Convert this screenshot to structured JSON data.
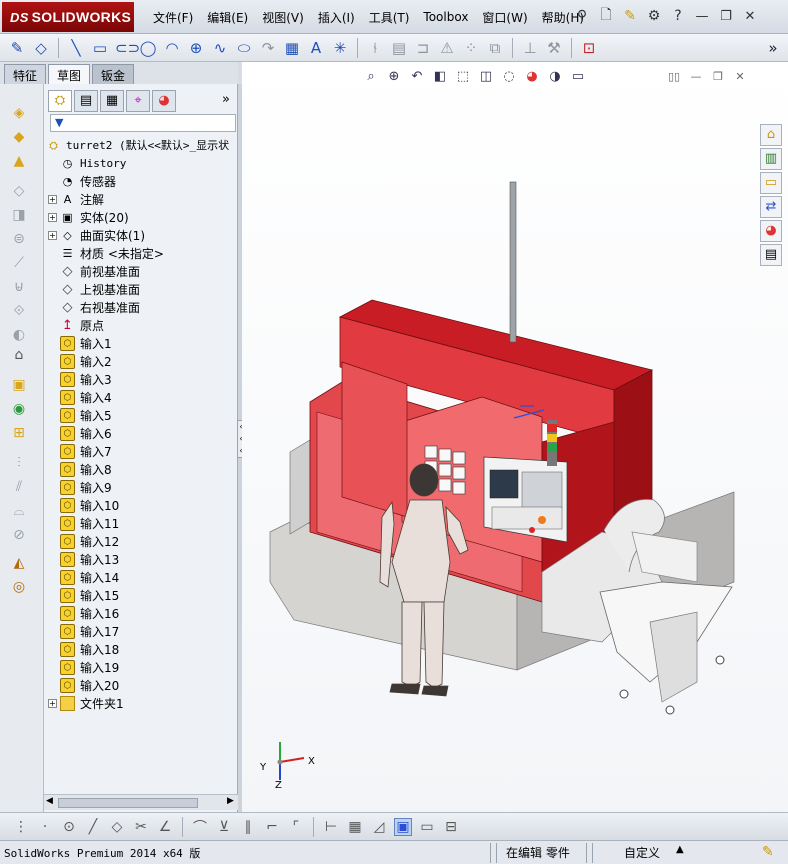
{
  "app": {
    "logo": "SOLIDWORKS",
    "menus": [
      "文件(F)",
      "编辑(E)",
      "视图(V)",
      "插入(I)",
      "工具(T)",
      "Toolbox",
      "窗口(W)",
      "帮助(H)"
    ]
  },
  "command_tabs": [
    "特征",
    "草图",
    "钣金"
  ],
  "active_tab": "草图",
  "feature_tree": {
    "root": "turret2  (默认<<默认>_显示状",
    "items": [
      {
        "label": "History",
        "icon": "history-icon",
        "expandable": false,
        "mono": true
      },
      {
        "label": "传感器",
        "icon": "sensor-icon",
        "expandable": false
      },
      {
        "label": "注解",
        "icon": "annotation-icon",
        "expandable": true
      },
      {
        "label": "实体(20)",
        "icon": "solid-bodies-icon",
        "expandable": true
      },
      {
        "label": "曲面实体(1)",
        "icon": "surface-bodies-icon",
        "expandable": true
      },
      {
        "label": "材质 <未指定>",
        "icon": "material-icon",
        "expandable": false
      },
      {
        "label": "前视基准面",
        "icon": "plane-icon",
        "expandable": false
      },
      {
        "label": "上视基准面",
        "icon": "plane-icon",
        "expandable": false
      },
      {
        "label": "右视基准面",
        "icon": "plane-icon",
        "expandable": false
      },
      {
        "label": "原点",
        "icon": "origin-icon",
        "expandable": false
      },
      {
        "label": "输入1",
        "icon": "import-icon",
        "expandable": false
      },
      {
        "label": "输入2",
        "icon": "import-icon",
        "expandable": false
      },
      {
        "label": "输入3",
        "icon": "import-icon",
        "expandable": false
      },
      {
        "label": "输入4",
        "icon": "import-icon",
        "expandable": false
      },
      {
        "label": "输入5",
        "icon": "import-icon",
        "expandable": false
      },
      {
        "label": "输入6",
        "icon": "import-icon",
        "expandable": false
      },
      {
        "label": "输入7",
        "icon": "import-icon",
        "expandable": false
      },
      {
        "label": "输入8",
        "icon": "import-icon",
        "expandable": false
      },
      {
        "label": "输入9",
        "icon": "import-icon",
        "expandable": false
      },
      {
        "label": "输入10",
        "icon": "import-icon",
        "expandable": false
      },
      {
        "label": "输入11",
        "icon": "import-icon",
        "expandable": false
      },
      {
        "label": "输入12",
        "icon": "import-icon",
        "expandable": false
      },
      {
        "label": "输入13",
        "icon": "import-icon",
        "expandable": false
      },
      {
        "label": "输入14",
        "icon": "import-icon",
        "expandable": false
      },
      {
        "label": "输入15",
        "icon": "import-icon",
        "expandable": false
      },
      {
        "label": "输入16",
        "icon": "import-icon",
        "expandable": false
      },
      {
        "label": "输入17",
        "icon": "import-icon",
        "expandable": false
      },
      {
        "label": "输入18",
        "icon": "import-icon",
        "expandable": false
      },
      {
        "label": "输入19",
        "icon": "import-icon",
        "expandable": false
      },
      {
        "label": "输入20",
        "icon": "import-icon",
        "expandable": false
      },
      {
        "label": "文件夹1",
        "icon": "folder-icon",
        "expandable": true
      }
    ]
  },
  "triad": {
    "x": "X",
    "y": "Y",
    "z": "Z"
  },
  "status": {
    "product": "SolidWorks Premium 2014 x64 版",
    "editing": "在编辑 零件",
    "units": "自定义"
  },
  "colors": {
    "accent": "#b01313",
    "machine_red": "#d8232a",
    "viewport_bg": "#ffffff"
  }
}
